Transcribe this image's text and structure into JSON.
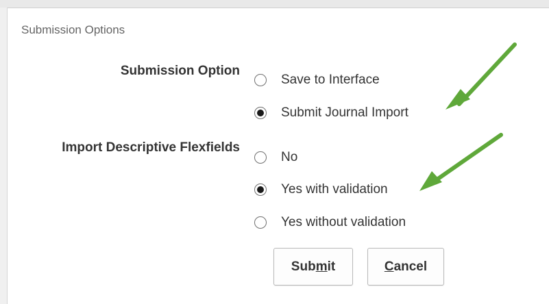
{
  "dialog": {
    "title": "Submission Options"
  },
  "submission_option": {
    "label": "Submission Option",
    "options": [
      {
        "label": "Save to Interface",
        "selected": false
      },
      {
        "label": "Submit Journal Import",
        "selected": true
      }
    ]
  },
  "import_flexfields": {
    "label": "Import Descriptive Flexfields",
    "options": [
      {
        "label": "No",
        "selected": false
      },
      {
        "label": "Yes with validation",
        "selected": true
      },
      {
        "label": "Yes without validation",
        "selected": false
      }
    ]
  },
  "buttons": {
    "submit": {
      "before": "Sub",
      "mnemonic": "m",
      "after": "it"
    },
    "cancel": {
      "before": "",
      "mnemonic": "C",
      "after": "ancel"
    }
  },
  "colors": {
    "annotation_arrow": "#5fa83a",
    "text": "#333333",
    "title": "#646464"
  }
}
